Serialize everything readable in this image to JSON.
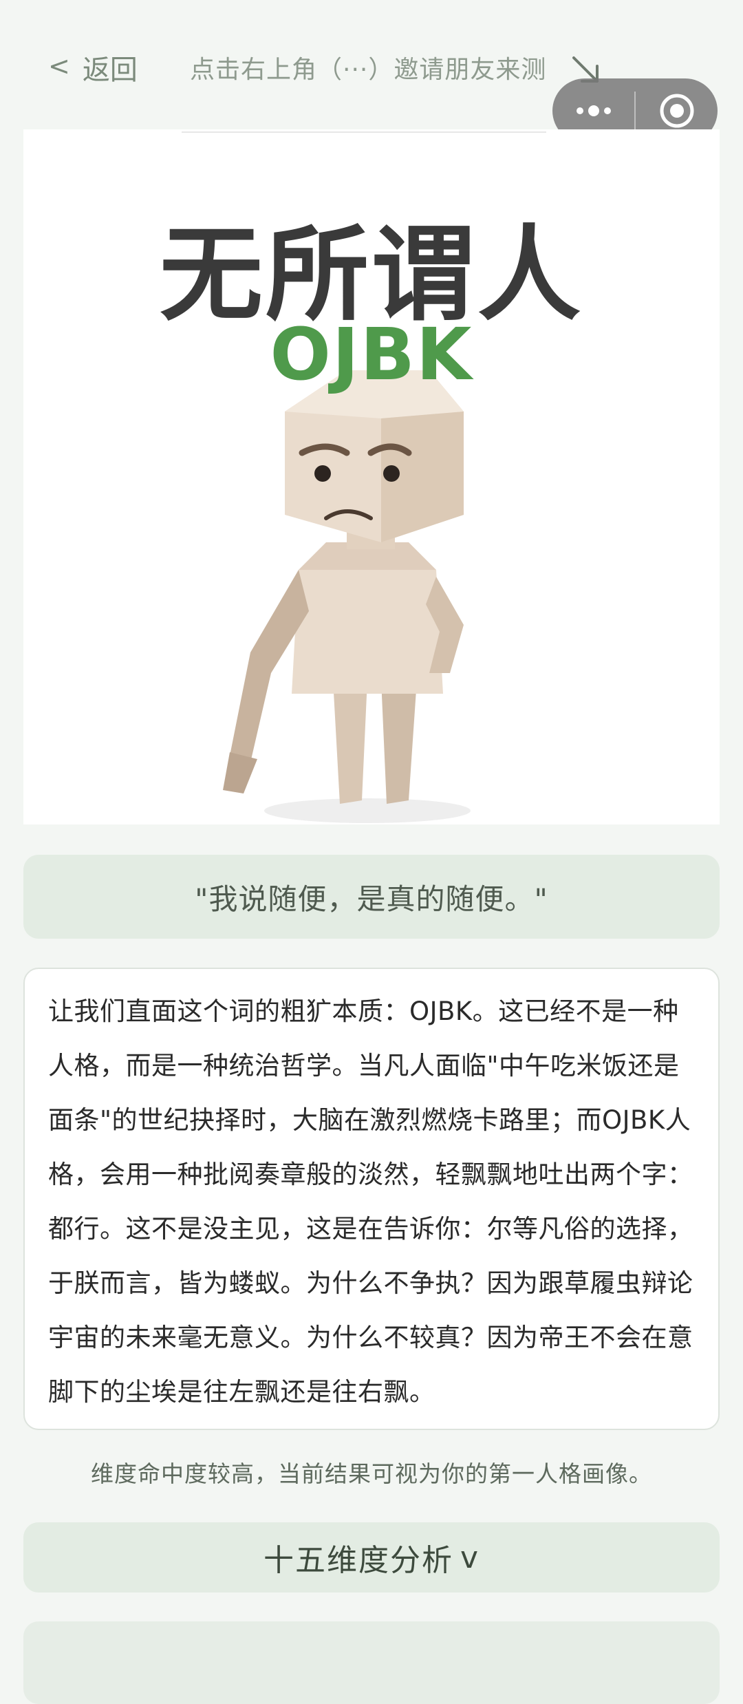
{
  "header": {
    "back_chevron": "<",
    "back_label": "返回",
    "invite_text": "点击右上角（···）邀请朋友来测",
    "arrow_icon": "arrow-down-right-icon"
  },
  "capsule": {
    "more_icon": "more-dots-icon",
    "close_icon": "target-close-icon"
  },
  "result": {
    "type_name": "无所谓人",
    "type_code": "OJBK"
  },
  "quote": "\"我说随便，是真的随便。\"",
  "description": "让我们直面这个词的粗犷本质：OJBK。这已经不是一种人格，而是一种统治哲学。当凡人面临\"中午吃米饭还是面条\"的世纪抉择时，大脑在激烈燃烧卡路里；而OJBK人格，会用一种批阅奏章般的淡然，轻飘飘地吐出两个字：都行。这不是没主见，这是在告诉你：尔等凡俗的选择，于朕而言，皆为蝼蚁。为什么不争执？因为跟草履虫辩论宇宙的未来毫无意义。为什么不较真？因为帝王不会在意脚下的尘埃是往左飘还是往右飘。",
  "summary": "维度命中度较高，当前结果可视为你的第一人格画像。",
  "analysis": {
    "label": "十五维度分析",
    "chevron": "v"
  },
  "colors": {
    "accent_green": "#4f9a4b",
    "panel_green": "#e3ece3",
    "background": "#f3f6f3"
  }
}
